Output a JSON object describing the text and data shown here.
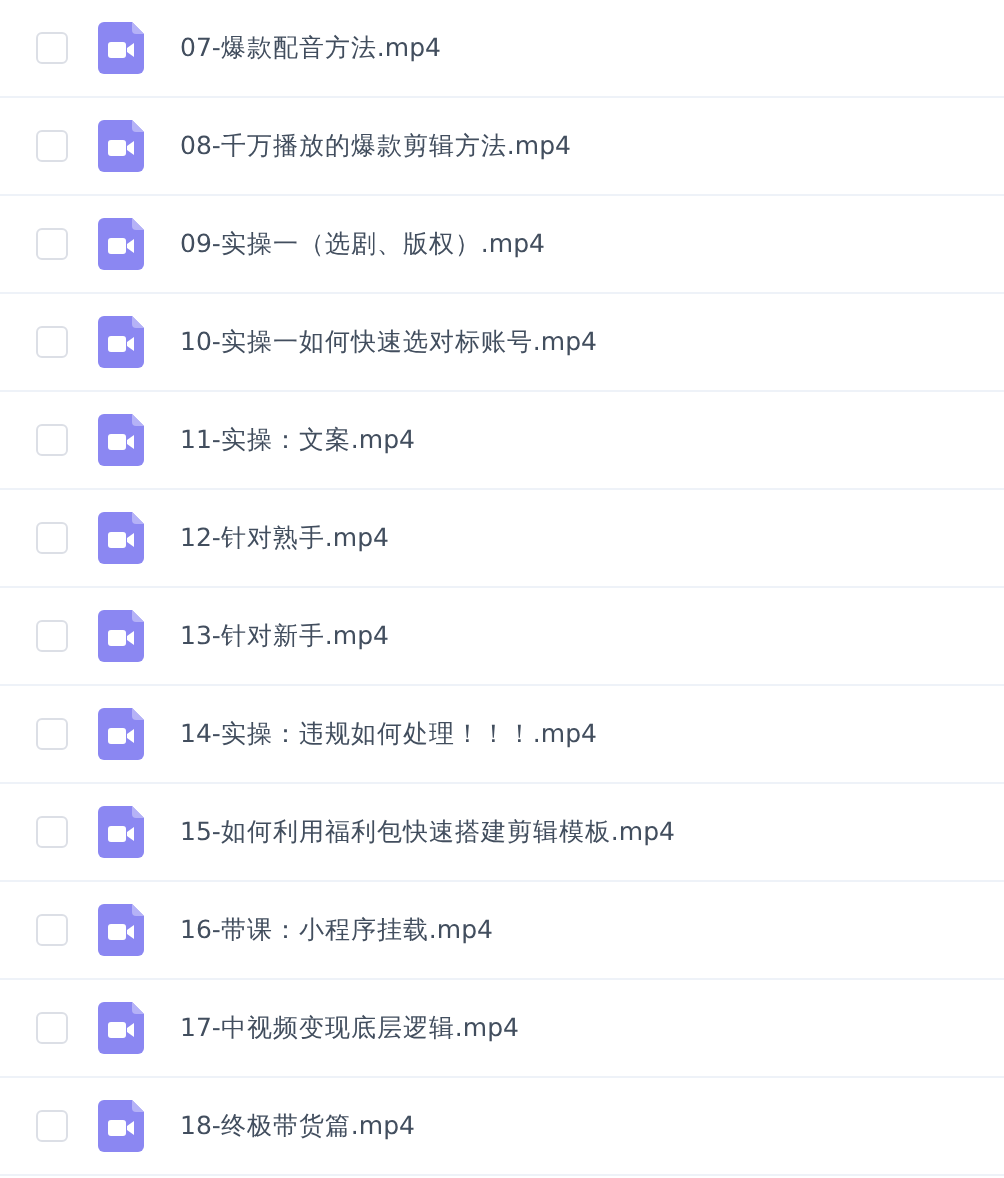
{
  "files": [
    {
      "name": "07-爆款配音方法.mp4",
      "checked": false
    },
    {
      "name": "08-千万播放的爆款剪辑方法.mp4",
      "checked": false
    },
    {
      "name": "09-实操一（选剧、版权）.mp4",
      "checked": false
    },
    {
      "name": "10-实操一如何快速选对标账号.mp4",
      "checked": false
    },
    {
      "name": "11-实操：文案.mp4",
      "checked": false
    },
    {
      "name": "12-针对熟手.mp4",
      "checked": false
    },
    {
      "name": "13-针对新手.mp4",
      "checked": false
    },
    {
      "name": "14-实操：违规如何处理！！！.mp4",
      "checked": false
    },
    {
      "name": "15-如何利用福利包快速搭建剪辑模板.mp4",
      "checked": false
    },
    {
      "name": "16-带课：小程序挂载.mp4",
      "checked": false
    },
    {
      "name": "17-中视频变现底层逻辑.mp4",
      "checked": false
    },
    {
      "name": "18-终极带货篇.mp4",
      "checked": false
    }
  ]
}
